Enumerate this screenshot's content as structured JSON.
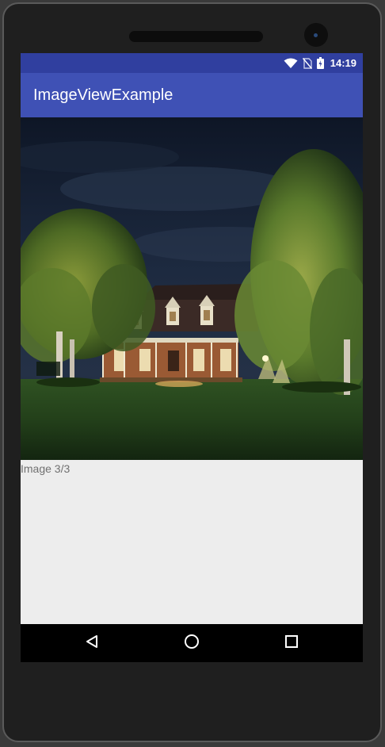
{
  "status_bar": {
    "time": "14:19",
    "icons": [
      "wifi-icon",
      "no-sim-icon",
      "battery-charging-icon"
    ],
    "background": "#303f9f"
  },
  "app_bar": {
    "title": "ImageViewExample",
    "background": "#3f51b5"
  },
  "image_view": {
    "description_icon": "house-night-photo",
    "counter_text": "Image 3/3"
  },
  "nav_bar": {
    "buttons": [
      "back-icon",
      "home-icon",
      "recents-icon"
    ]
  }
}
